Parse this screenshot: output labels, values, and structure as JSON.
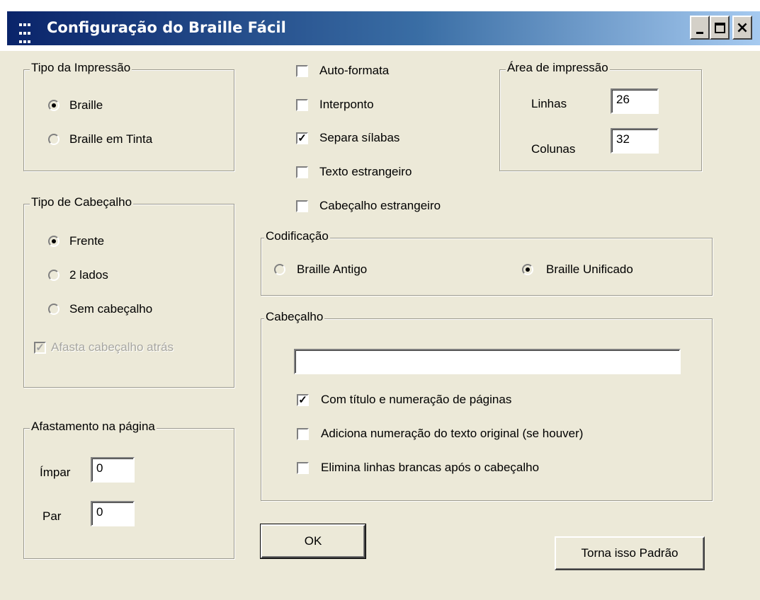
{
  "window": {
    "title": "Configuração do Braille Fácil",
    "minimize_icon": "minimize-icon",
    "maximize_icon": "maximize-icon",
    "close_glyph": "×"
  },
  "tipo_impressao": {
    "legend": "Tipo da Impressão",
    "options": [
      {
        "label": "Braille",
        "selected": true
      },
      {
        "label": "Braille em Tinta",
        "selected": false
      }
    ]
  },
  "tipo_cabecalho": {
    "legend": "Tipo de Cabeçalho",
    "options": [
      {
        "label": "Frente",
        "selected": true
      },
      {
        "label": "2 lados",
        "selected": false
      },
      {
        "label": "Sem cabeçalho",
        "selected": false
      }
    ],
    "afasta_label": "Afasta cabeçalho atrás",
    "afasta_checked": true
  },
  "afastamento": {
    "legend": "Afastamento na  página",
    "impar_label": "Ímpar",
    "impar_value": "0",
    "par_label": "Par",
    "par_value": "0"
  },
  "options": [
    {
      "label": "Auto-formata",
      "checked": false
    },
    {
      "label": "Interponto",
      "checked": false
    },
    {
      "label": "Separa sílabas",
      "checked": true
    },
    {
      "label": "Texto estrangeiro",
      "checked": false
    },
    {
      "label": "Cabeçalho estrangeiro",
      "checked": false
    }
  ],
  "area_impressao": {
    "legend": "Área de impressão",
    "linhas_label": "Linhas",
    "linhas_value": "26",
    "colunas_label": "Colunas",
    "colunas_value": "32"
  },
  "codificacao": {
    "legend": "Codificação",
    "options": [
      {
        "label": "Braille Antigo",
        "selected": false
      },
      {
        "label": "Braille Unificado",
        "selected": true
      }
    ]
  },
  "cabecalho": {
    "legend": "Cabeçalho",
    "text_value": "",
    "checks": [
      {
        "label": "Com título e numeração de páginas",
        "checked": true
      },
      {
        "label": "Adiciona numeração do texto original (se houver)",
        "checked": false
      },
      {
        "label": "Elimina linhas brancas após o cabeçalho",
        "checked": false
      }
    ]
  },
  "buttons": {
    "ok": "OK",
    "torna_padrao": "Torna isso Padrão"
  },
  "check_glyph": "✓"
}
